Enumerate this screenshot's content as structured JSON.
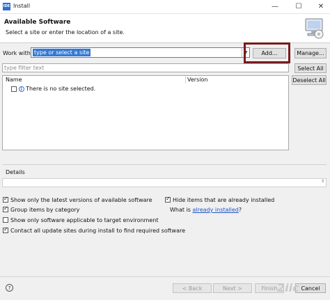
{
  "window": {
    "title": "Install",
    "icon_text": "IDE",
    "controls": [
      "—",
      "☐",
      "✕"
    ]
  },
  "header": {
    "title": "Available Software",
    "description": "Select a site or enter the location of a site."
  },
  "work_with": {
    "label": "Work with:",
    "value": "type or select a site",
    "add_label": "Add...",
    "manage_label": "Manage..."
  },
  "filter": {
    "placeholder": "type filter text",
    "select_all_label": "Select All",
    "deselect_all_label": "Deselect All"
  },
  "table": {
    "columns": [
      "Name",
      "Version"
    ],
    "rows": [
      {
        "name": "There is no site selected.",
        "version": ""
      }
    ]
  },
  "details": {
    "label": "Details"
  },
  "options": {
    "latest_versions": {
      "label": "Show only the latest versions of available software",
      "checked": true
    },
    "group_by_category": {
      "label": "Group items by category",
      "checked": true
    },
    "target_env": {
      "label": "Show only software applicable to target environment",
      "checked": false
    },
    "contact_sites": {
      "label": "Contact all update sites during install to find required software",
      "checked": true
    },
    "hide_installed": {
      "label": "Hide items that are already installed",
      "checked": true
    },
    "what_is_prefix": "What is ",
    "already_installed_link": "already installed",
    "what_is_suffix": "?"
  },
  "footer": {
    "back_label": "< Back",
    "next_label": "Next >",
    "finish_label": "Finish",
    "cancel_label": "Cancel"
  },
  "watermark": "2iic"
}
